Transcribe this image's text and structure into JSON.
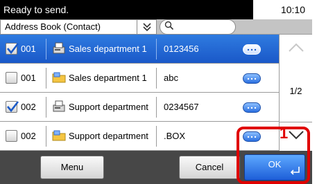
{
  "status": {
    "message": "Ready to send.",
    "time": "10:10"
  },
  "address_book": {
    "selected": "Address Book (Contact)",
    "dropdown_icon": "double-chevron-down-icon",
    "search_icon": "search-icon",
    "search_value": ""
  },
  "rows": [
    {
      "checked": true,
      "selected": true,
      "number": "001",
      "icon": "fax-machine-icon",
      "name": "Sales department 1",
      "destination": "0123456"
    },
    {
      "checked": false,
      "selected": false,
      "number": "001",
      "icon": "folder-icon",
      "name": "Sales department 1",
      "destination": "abc"
    },
    {
      "checked": true,
      "selected": false,
      "number": "002",
      "icon": "fax-machine-icon",
      "name": "Support department",
      "destination": "0234567"
    },
    {
      "checked": false,
      "selected": false,
      "number": "002",
      "icon": "folder-icon",
      "name": "Support department",
      "destination": ".BOX"
    }
  ],
  "pager": {
    "page": "1/2"
  },
  "buttons": {
    "menu": "Menu",
    "cancel": "Cancel",
    "ok": "OK"
  },
  "callout": {
    "step": "1",
    "color": "#e00000"
  },
  "side_code": "",
  "colors": {
    "selected_row": "#1f63d2",
    "status_bar": "#000000",
    "bottom_bar": "#474747",
    "ok_button": "#2a72e6"
  }
}
